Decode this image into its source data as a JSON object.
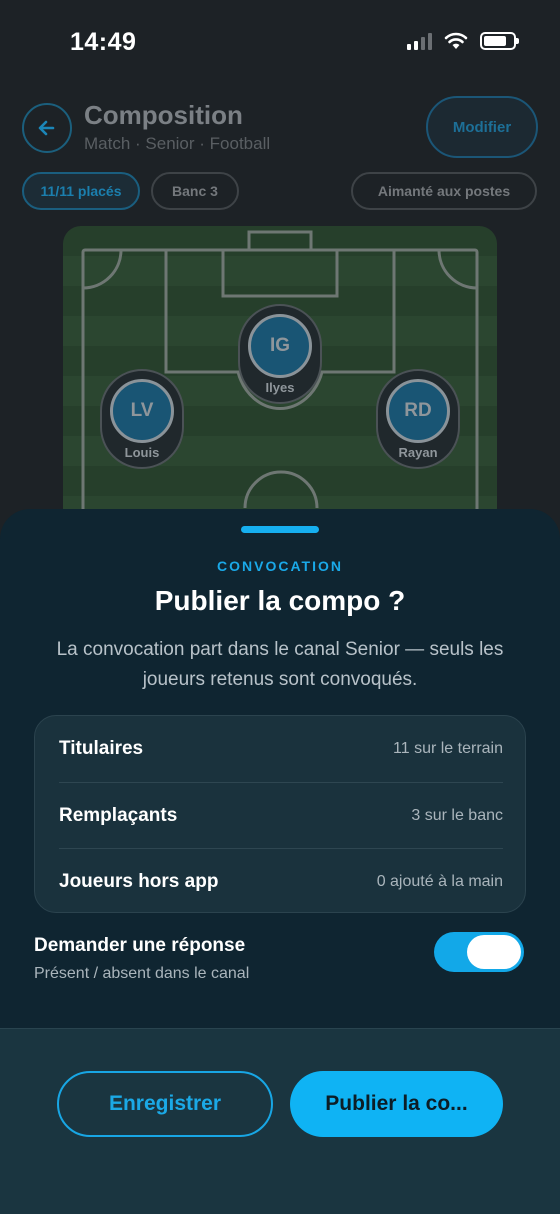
{
  "status": {
    "time": "14:49"
  },
  "header": {
    "title": "Composition",
    "subtitle": "Match · Senior · Football",
    "modify_label": "Modifier"
  },
  "chips": {
    "placed": "11/11 placés",
    "banc": "Banc 3",
    "aimant": "Aimanté aux postes"
  },
  "players": [
    {
      "initials": "IG",
      "name": "Ilyes"
    },
    {
      "initials": "LV",
      "name": "Louis"
    },
    {
      "initials": "RD",
      "name": "Rayan"
    }
  ],
  "sheet": {
    "eyebrow": "CONVOCATION",
    "title": "Publier la compo ?",
    "description": "La convocation part dans le canal Senior — seuls les joueurs retenus sont convoqués.",
    "rows": [
      {
        "label": "Titulaires",
        "value": "11 sur le terrain"
      },
      {
        "label": "Remplaçants",
        "value": "3 sur le banc"
      },
      {
        "label": "Joueurs hors app",
        "value": "0 ajouté à la main"
      }
    ],
    "toggle": {
      "title": "Demander une réponse",
      "subtitle": "Présent / absent dans le canal",
      "on": true
    }
  },
  "footer": {
    "save_label": "Enregistrer",
    "publish_label": "Publier la co..."
  },
  "colors": {
    "accent": "#0fb3f4",
    "sheet_bg": "#0f2531",
    "background": "#1d2226"
  }
}
